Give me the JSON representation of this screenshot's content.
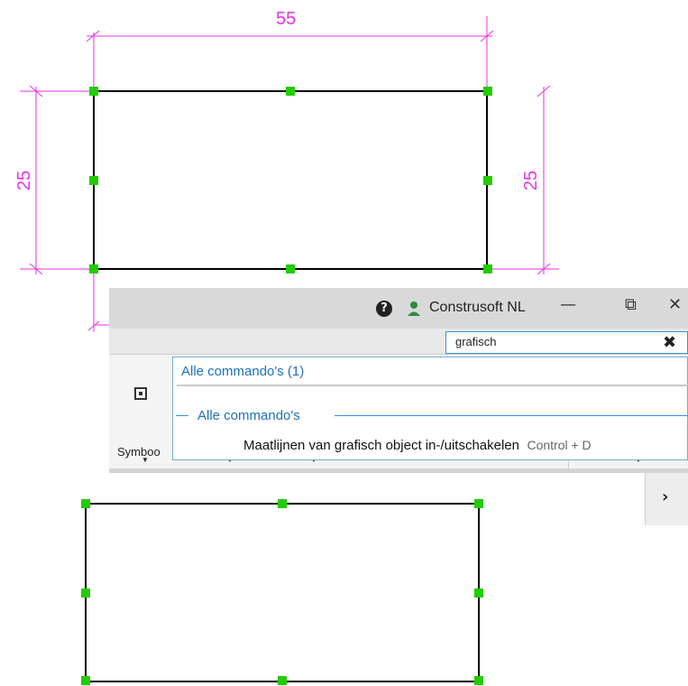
{
  "drawing": {
    "dim_top": "55",
    "dim_left": "25",
    "dim_right": "25",
    "line_color": "#e632e6",
    "grip_color": "#22cc00"
  },
  "titlebar": {
    "help_icon": "?",
    "user_name": "Construsoft NL",
    "minimize_glyph": "—",
    "restore_glyph": "⧉",
    "close_glyph": "✕"
  },
  "search": {
    "value": "grafisch",
    "clear_glyph": "✖"
  },
  "ribbon": {
    "symbol_label": "Symboo",
    "side_chevron": "›"
  },
  "dropdown": {
    "header": "Alle commando's  (1)",
    "group_label": "Alle commando's",
    "item_label": "Maatlijnen van grafisch object in-/uitschakelen",
    "item_shortcut": "Control + D"
  }
}
